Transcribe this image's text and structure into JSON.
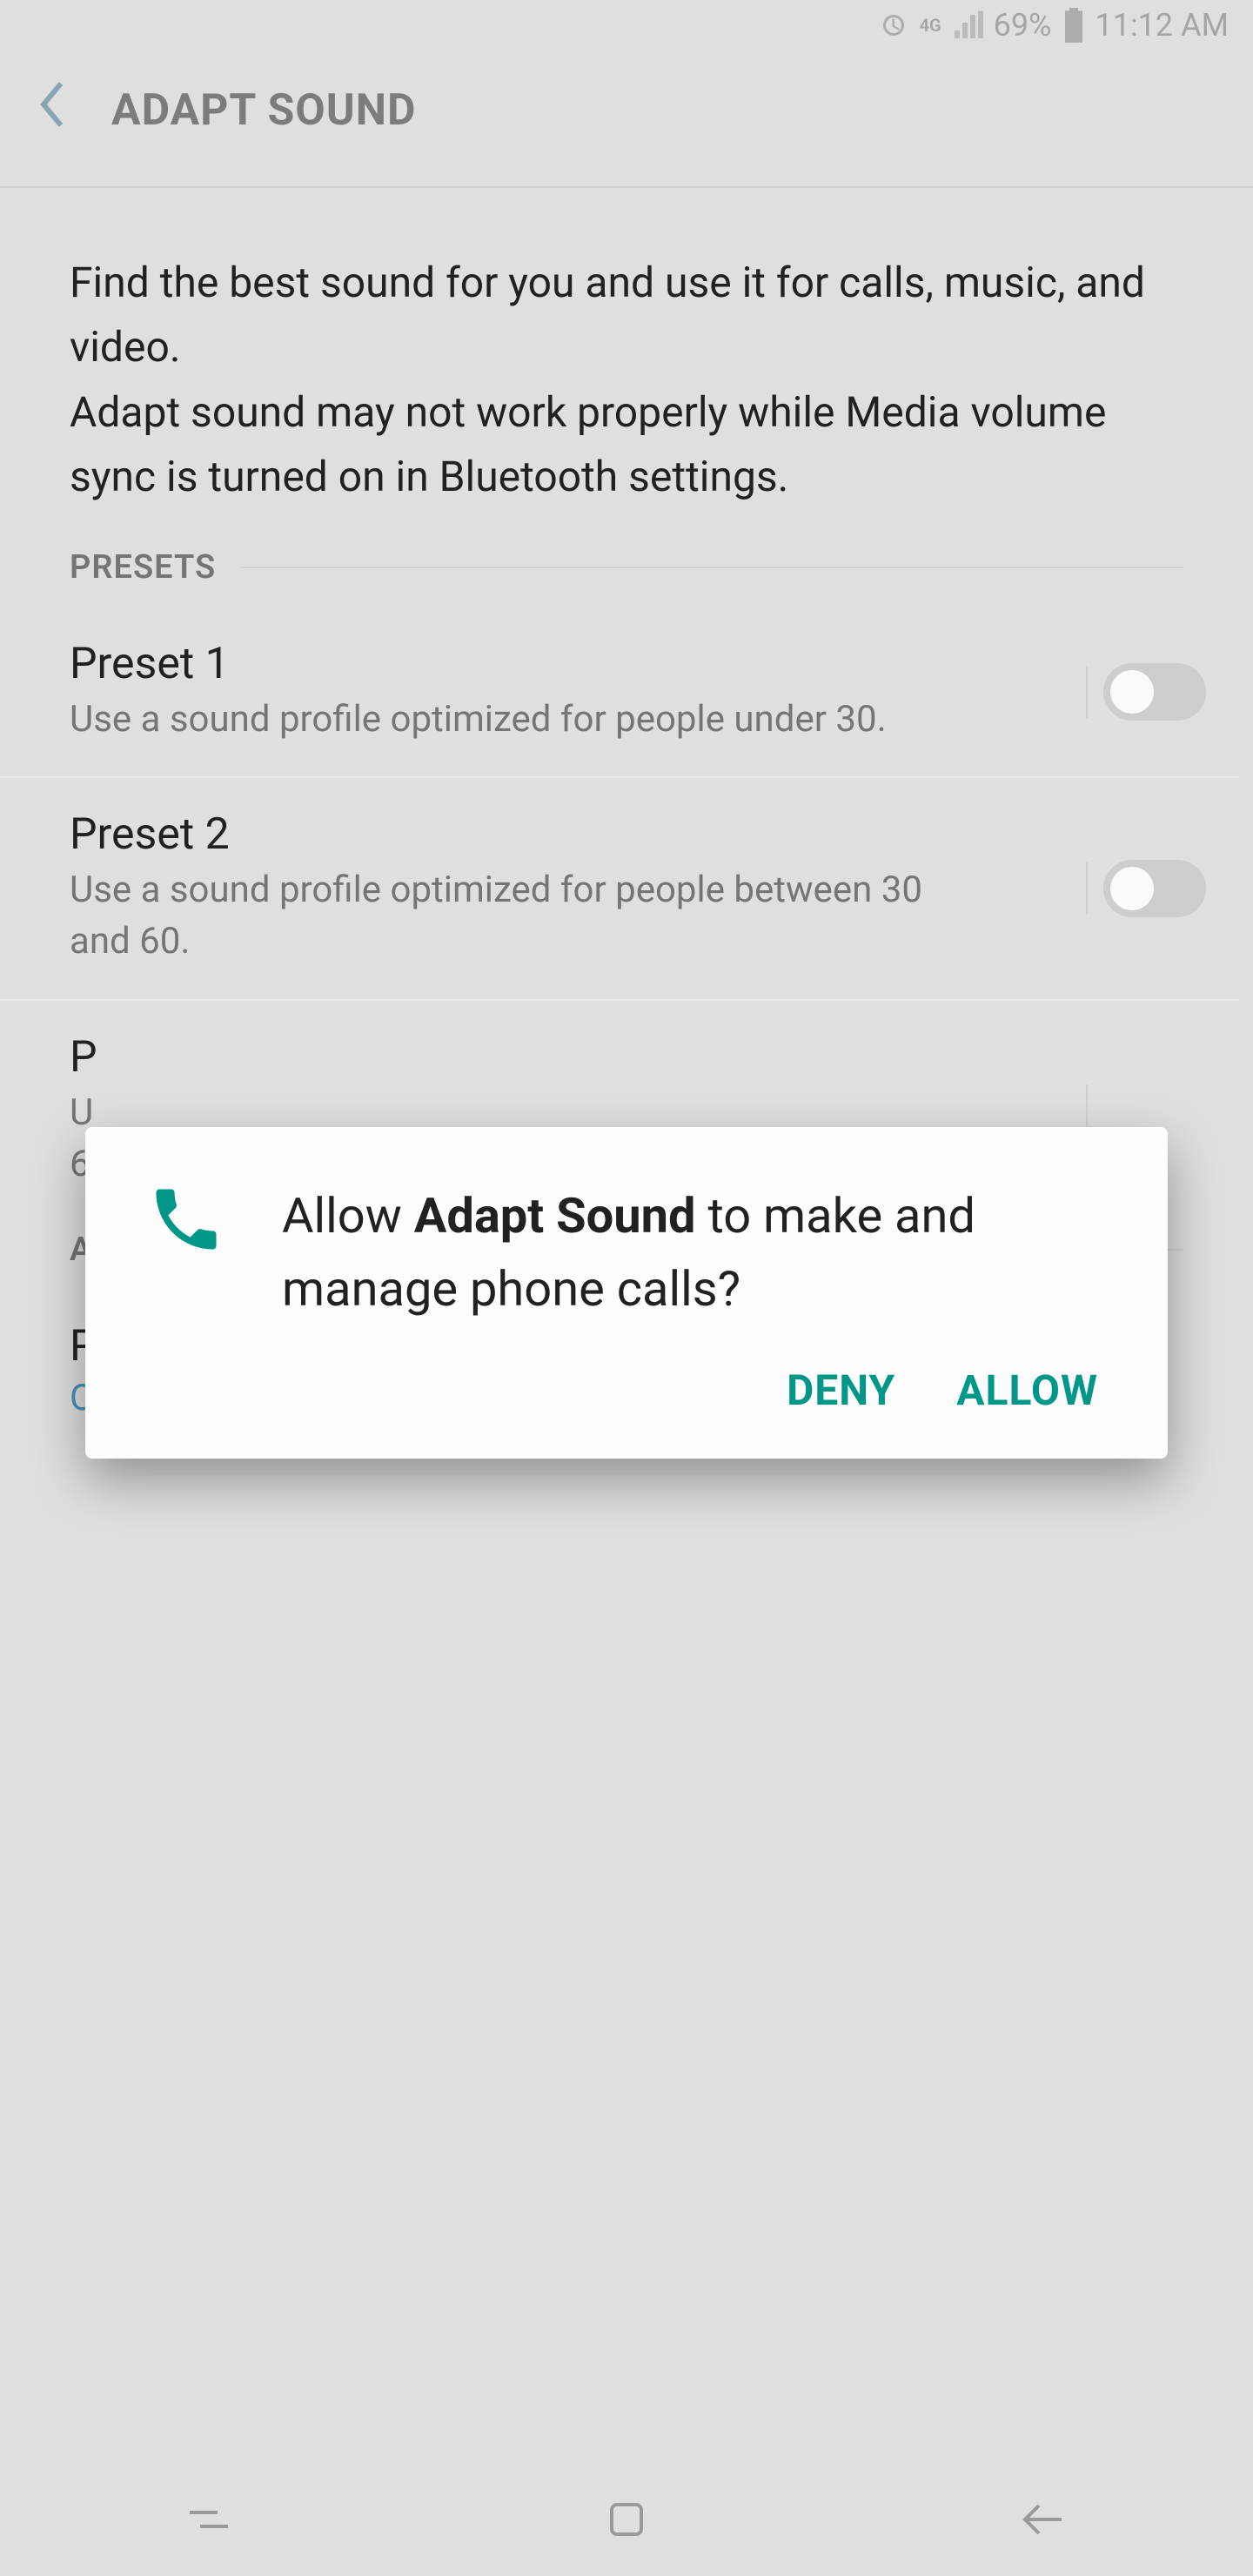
{
  "status_bar": {
    "battery": "69%",
    "time": "11:12 AM"
  },
  "header": {
    "title": "ADAPT SOUND"
  },
  "description": "Find the best sound for you and use it for calls, music, and video.\nAdapt sound may not work properly while Media volume sync is turned on in Bluetooth settings.",
  "section": {
    "presets_label": "PRESETS",
    "advanced_label": "A"
  },
  "presets": [
    {
      "title": "Preset 1",
      "subtitle": "Use a sound profile optimized for people under 30."
    },
    {
      "title": "Preset 2",
      "subtitle": "Use a sound profile optimized for people between 30 and 60."
    },
    {
      "title": "P",
      "subtitle": "U\n6"
    }
  ],
  "personalize": {
    "title": "Personalize sound",
    "status": "OFF"
  },
  "dialog": {
    "prefix": "Allow ",
    "app_name": "Adapt Sound",
    "suffix": " to make and manage phone calls?",
    "deny": "DENY",
    "allow": "ALLOW"
  },
  "accent_color": "#009688"
}
